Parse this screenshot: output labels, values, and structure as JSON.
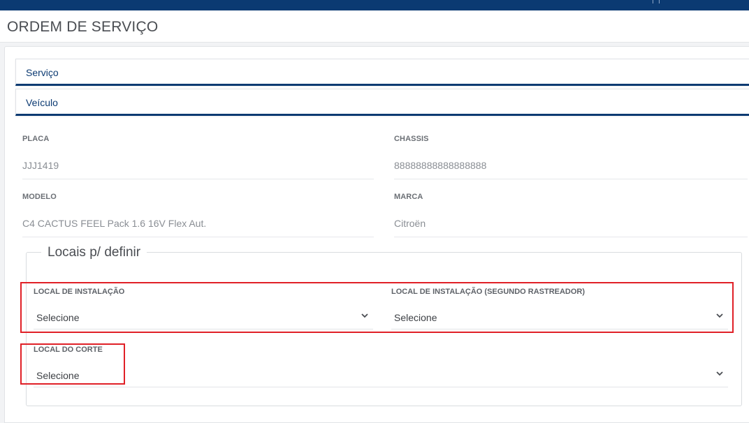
{
  "page": {
    "title": "ORDEM DE SERVIÇO"
  },
  "accordion": {
    "servico_label": "Serviço",
    "veiculo_label": "Veículo"
  },
  "vehicle": {
    "placa_label": "PLACA",
    "placa_value": "JJJ1419",
    "chassis_label": "CHASSIS",
    "chassis_value": "88888888888888888",
    "modelo_label": "MODELO",
    "modelo_value": "C4 CACTUS FEEL Pack 1.6 16V Flex Aut.",
    "marca_label": "MARCA",
    "marca_value": "Citroën"
  },
  "locais": {
    "legend": "Locais p/ definir",
    "instalacao_label": "LOCAL DE INSTALAÇÃO",
    "instalacao_value": "Selecione",
    "instalacao2_label": "LOCAL DE INSTALAÇÃO (SEGUNDO RASTREADOR)",
    "instalacao2_value": "Selecione",
    "corte_label": "LOCAL DO CORTE",
    "corte_value": "Selecione"
  },
  "colors": {
    "brand": "#0b3a72",
    "highlight": "#e02027"
  },
  "icons": {
    "chevron": "chevron-down-icon"
  }
}
